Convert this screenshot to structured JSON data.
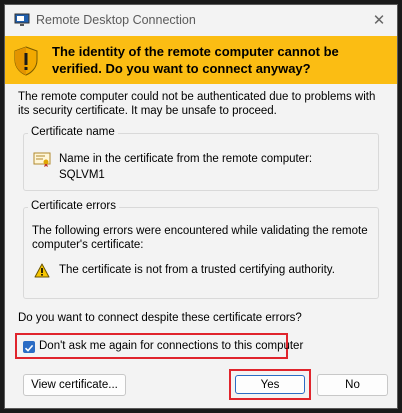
{
  "window": {
    "title": "Remote Desktop Connection",
    "close_glyph": "✕",
    "app_icon": "remote-desktop-icon"
  },
  "banner": {
    "text": "The identity of the remote computer cannot be verified. Do you want to connect anyway?",
    "icon": "shield-warning-icon",
    "color": "#fbbd13"
  },
  "intro_text": "The remote computer could not be authenticated due to problems with its security certificate. It may be unsafe to proceed.",
  "certificate_name": {
    "label": "Certificate name",
    "line1": "Name in the certificate from the remote computer:",
    "line2": "SQLVM1",
    "icon": "certificate-icon"
  },
  "certificate_errors": {
    "label": "Certificate errors",
    "intro": "The following errors were encountered while validating the remote computer's certificate:",
    "items": [
      {
        "icon": "warning-icon",
        "text": "The certificate is not from a trusted certifying authority."
      }
    ]
  },
  "question": "Do you want to connect despite these certificate errors?",
  "dont_ask": {
    "label": "Don't ask me again for connections to this computer",
    "checked": true
  },
  "buttons": {
    "view_certificate": "View certificate...",
    "yes": "Yes",
    "no": "No"
  },
  "colors": {
    "highlight_red": "#e0242c",
    "accent_blue": "#2b6cc4"
  }
}
